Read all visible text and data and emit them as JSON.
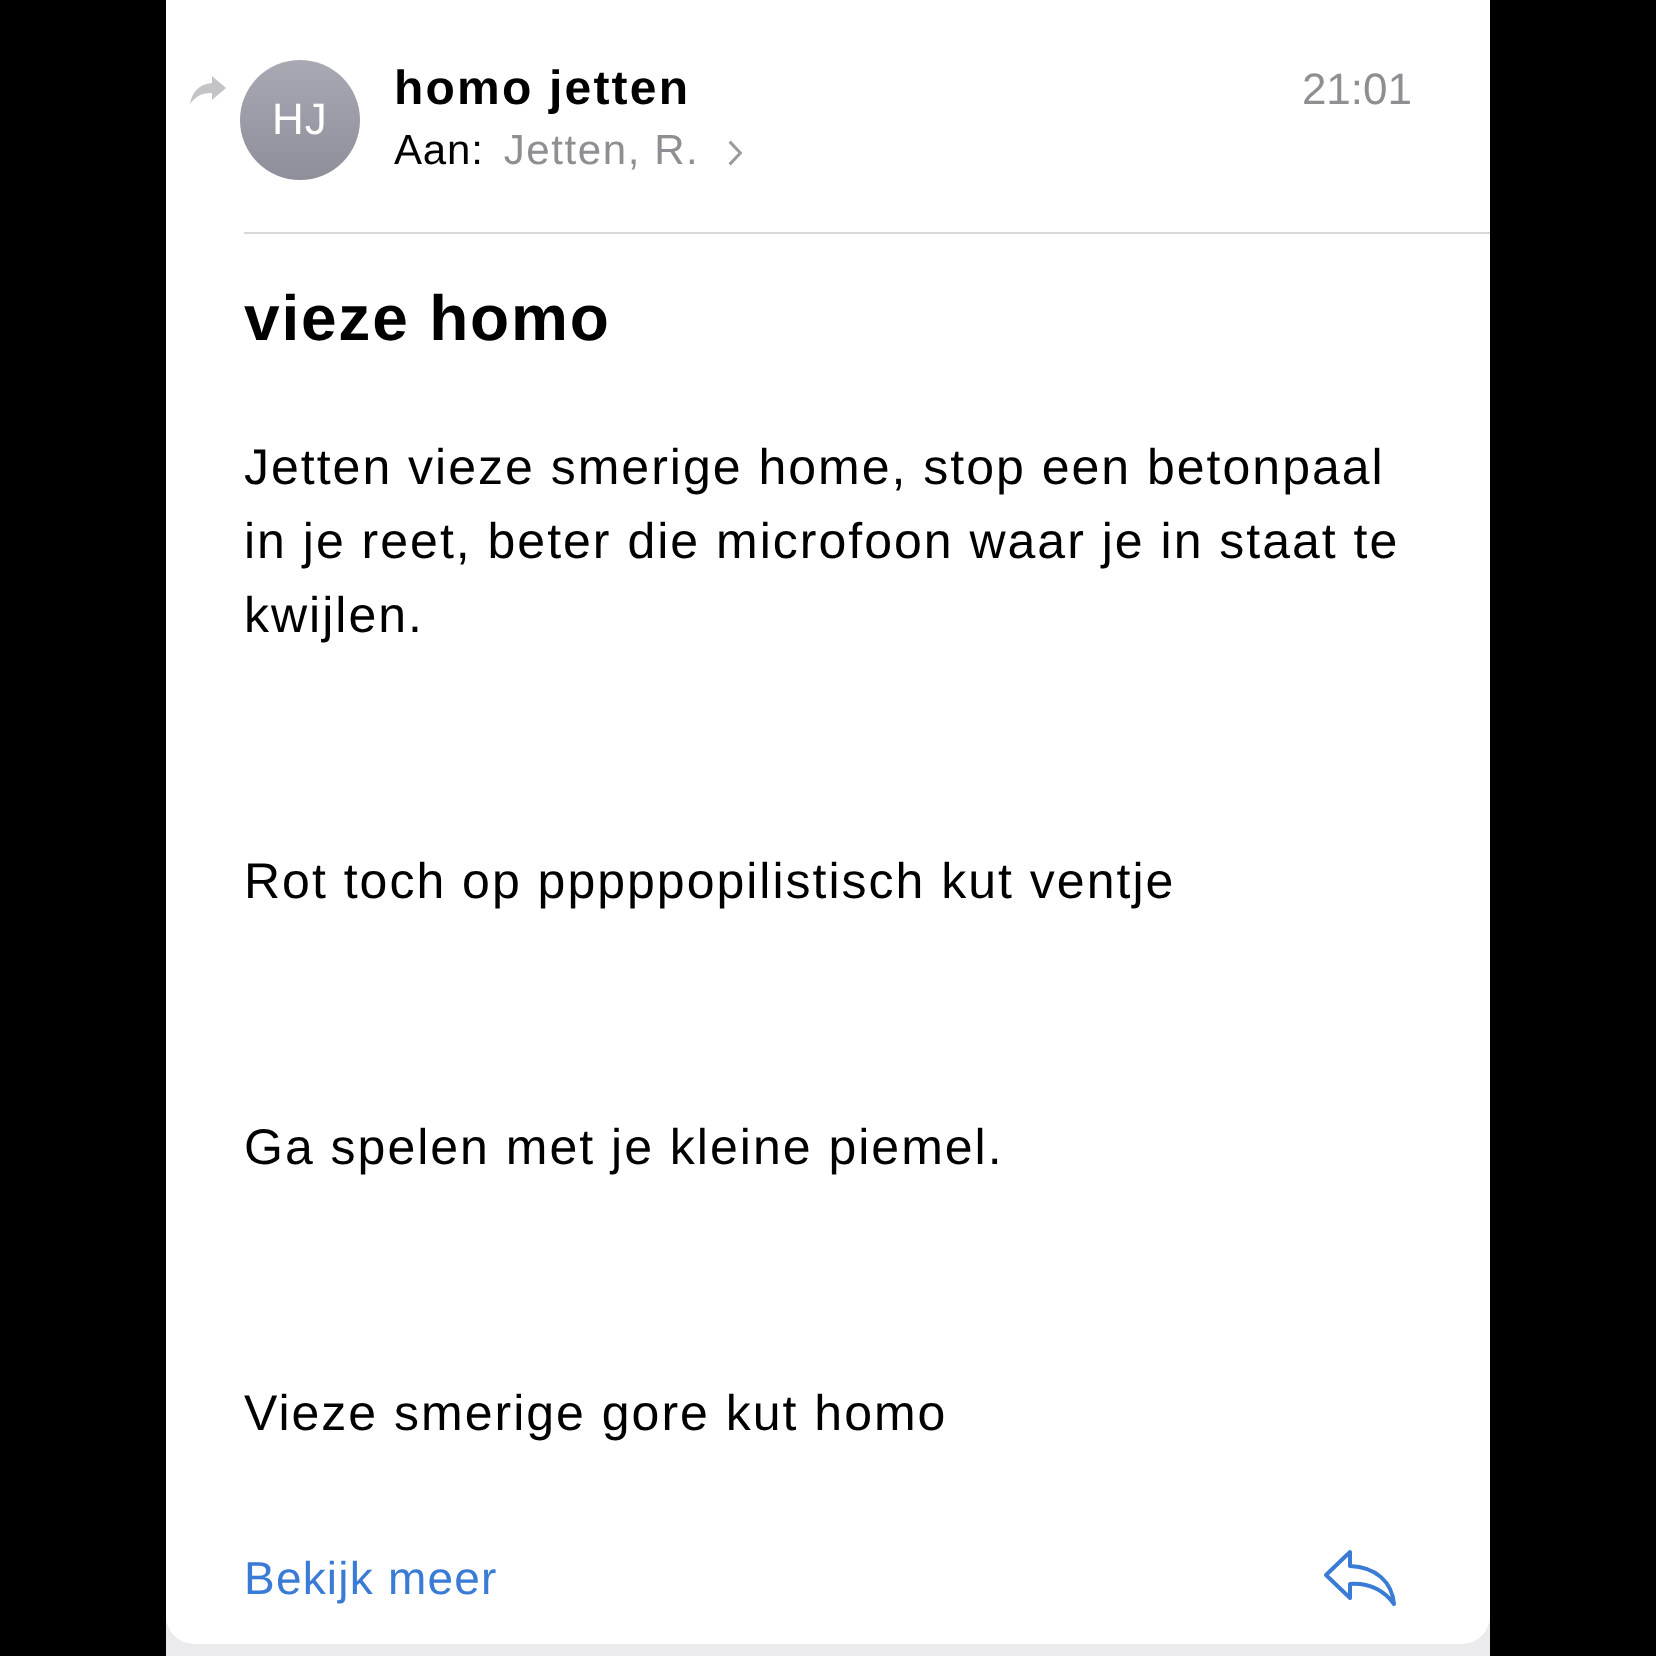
{
  "message": {
    "forwarded": true,
    "sender": {
      "initials": "HJ",
      "name": "homo jetten"
    },
    "time": "21:01",
    "recipient": {
      "label": "Aan:",
      "name": "Jetten, R."
    }
  },
  "subject": "vieze homo",
  "body": [
    "Jetten vieze smerige home, stop een betonpaal in je reet, beter die microfoon waar je in staat te kwijlen.",
    "Rot toch op pppppopilistisch kut ventje",
    "Ga spelen met je kleine piemel.",
    "Vieze smerige gore kut homo"
  ],
  "footer": {
    "link": "Bekijk meer"
  }
}
